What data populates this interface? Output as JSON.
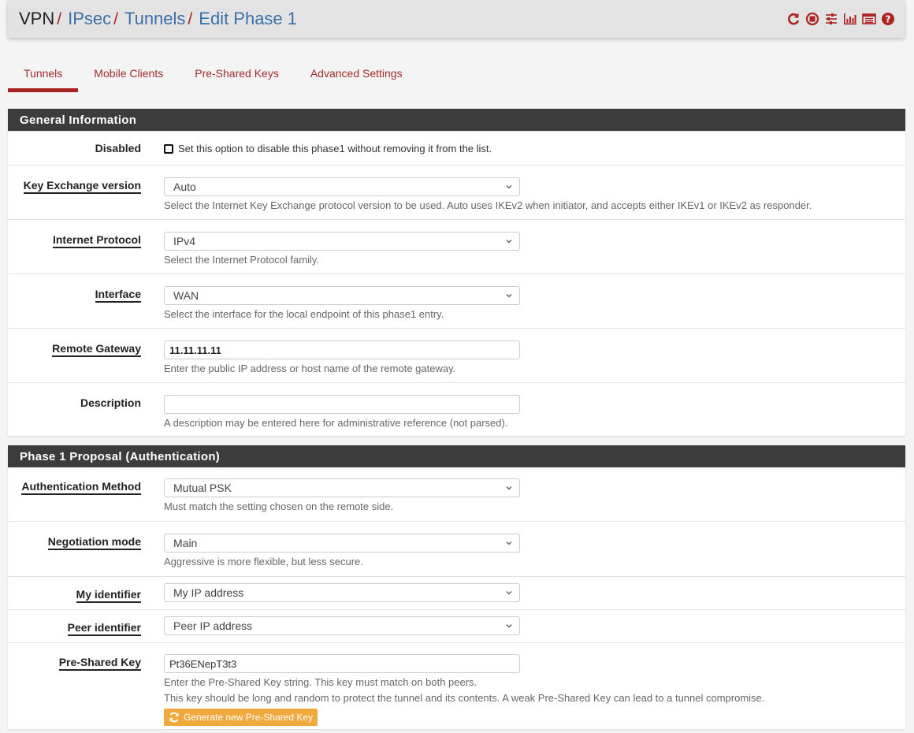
{
  "header": {
    "breadcrumb": [
      "VPN",
      "IPsec",
      "Tunnels",
      "Edit Phase 1"
    ],
    "separator": "/",
    "icons": [
      "restart-service-icon",
      "stop-service-icon",
      "settings-sliders-icon",
      "status-chart-icon",
      "log-list-icon",
      "help-icon"
    ],
    "accent": "#ad2222"
  },
  "tabs": [
    {
      "label": "Tunnels",
      "active": true
    },
    {
      "label": "Mobile Clients",
      "active": false
    },
    {
      "label": "Pre-Shared Keys",
      "active": false
    },
    {
      "label": "Advanced Settings",
      "active": false
    }
  ],
  "general": {
    "title": "General Information",
    "disabled": {
      "label": "Disabled",
      "checked": false,
      "text": "Set this option to disable this phase1 without removing it from the list."
    },
    "key_exchange": {
      "label": "Key Exchange version",
      "value": "Auto",
      "help": "Select the Internet Key Exchange protocol version to be used. Auto uses IKEv2 when initiator, and accepts either IKEv1 or IKEv2 as responder."
    },
    "protocol": {
      "label": "Internet Protocol",
      "value": "IPv4",
      "help": "Select the Internet Protocol family."
    },
    "interface": {
      "label": "Interface",
      "value": "WAN",
      "help": "Select the interface for the local endpoint of this phase1 entry."
    },
    "remote_gateway": {
      "label": "Remote Gateway",
      "value": "11.11.11.11",
      "help": "Enter the public IP address or host name of the remote gateway."
    },
    "description": {
      "label": "Description",
      "value": "",
      "help": "A description may be entered here for administrative reference (not parsed)."
    }
  },
  "proposal": {
    "title": "Phase 1 Proposal (Authentication)",
    "auth_method": {
      "label": "Authentication Method",
      "value": "Mutual PSK",
      "help": "Must match the setting chosen on the remote side."
    },
    "negotiation": {
      "label": "Negotiation mode",
      "value": "Main",
      "help": "Aggressive is more flexible, but less secure."
    },
    "my_id": {
      "label": "My identifier",
      "value": "My IP address"
    },
    "peer_id": {
      "label": "Peer identifier",
      "value": "Peer IP address"
    },
    "psk": {
      "label": "Pre-Shared Key",
      "value": "Pt36ENepT3t3",
      "help1": "Enter the Pre-Shared Key string. This key must match on both peers.",
      "help2": "This key should be long and random to protect the tunnel and its contents. A weak Pre-Shared Key can lead to a tunnel compromise.",
      "generate_label": "Generate new Pre-Shared Key",
      "generate_color": "#f0a93c"
    }
  }
}
